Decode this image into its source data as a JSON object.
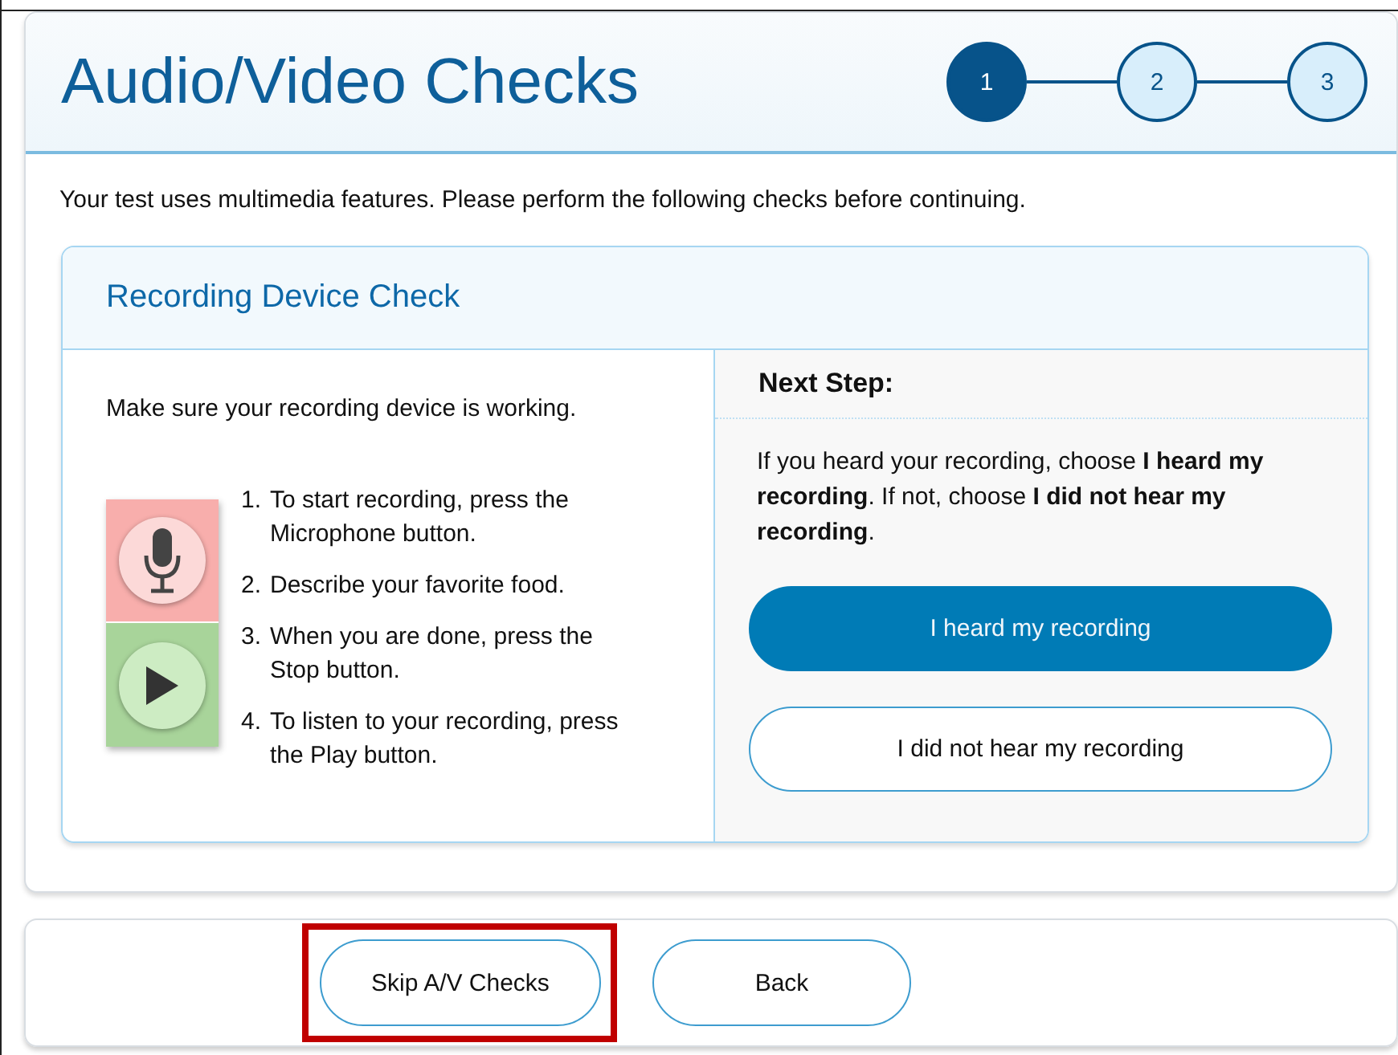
{
  "header": {
    "title": "Audio/Video Checks",
    "steps": [
      {
        "label": "1",
        "selected": true
      },
      {
        "label": "2",
        "selected": false
      },
      {
        "label": "3",
        "selected": false
      }
    ]
  },
  "intro": "Your test uses multimedia features. Please perform the following checks before continuing.",
  "card": {
    "title": "Recording Device Check",
    "instruction": "Make sure your recording device is working.",
    "controls": [
      {
        "kind": "microphone"
      },
      {
        "kind": "play"
      }
    ],
    "steps": [
      {
        "number": "1.",
        "text": "To start recording, press the Microphone button."
      },
      {
        "number": "2.",
        "text": "Describe your favorite food."
      },
      {
        "number": "3.",
        "text": "When you are done, press the Stop button."
      },
      {
        "number": "4.",
        "text": "To listen to your recording, press the Play button."
      }
    ],
    "next_step": {
      "heading": "Next Step:",
      "text": "If you heard your recording, choose **I heard my recording**. If not, choose **I did not hear my recording**.",
      "buttons": [
        {
          "label": "I heard my recording",
          "kind": "primary"
        },
        {
          "label": "I did not hear my recording",
          "kind": "secondary"
        }
      ]
    }
  },
  "footer": {
    "buttons": [
      {
        "label": "Skip A/V Checks",
        "highlighted": true
      },
      {
        "label": "Back",
        "highlighted": false
      }
    ]
  }
}
